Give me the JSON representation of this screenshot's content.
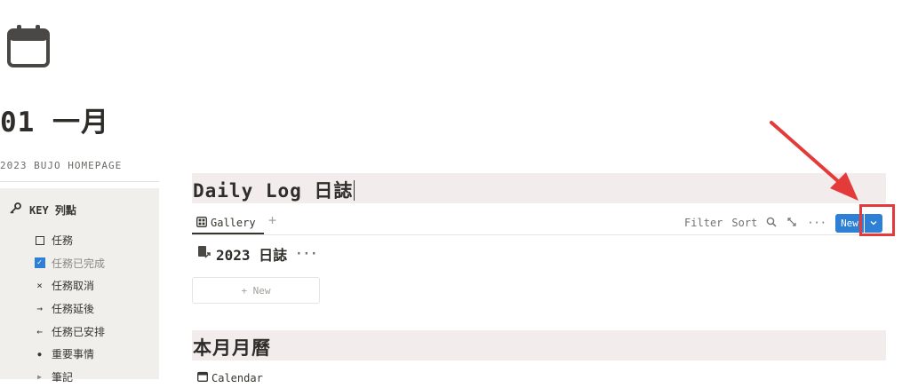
{
  "page": {
    "icon": "calendar-icon",
    "title": "01 一月",
    "parent_link": "2023 BUJO HOMEPAGE"
  },
  "key": {
    "header": "KEY 列點",
    "header_icon": "key-icon",
    "items": [
      {
        "symbol": "checkbox-empty",
        "label": "任務"
      },
      {
        "symbol": "checkbox-checked",
        "label": "任務已完成"
      },
      {
        "symbol": "×",
        "label": "任務取消"
      },
      {
        "symbol": "→",
        "label": "任務延後"
      },
      {
        "symbol": "←",
        "label": "任務已安排"
      },
      {
        "symbol": "●",
        "label": "重要事情"
      },
      {
        "symbol": "▶",
        "label": "筆記"
      }
    ]
  },
  "daily_log": {
    "title": "Daily Log 日誌",
    "view_tab": "Gallery",
    "toolbar": {
      "filter": "Filter",
      "sort": "Sort",
      "search_icon": "search-icon",
      "expand_icon": "expand-icon",
      "more": "···",
      "new_label": "New",
      "dropdown_icon": "chevron-down-icon"
    },
    "database_title": "2023 日誌",
    "database_more": "···",
    "new_card_label": "+ New"
  },
  "monthly_calendar": {
    "title": "本月月曆",
    "view_tab": "Calendar"
  },
  "colors": {
    "accent": "#2e7fd6",
    "highlight": "#e43a3a",
    "section_bg": "#f3ecec",
    "panel_bg": "#f1efec"
  }
}
